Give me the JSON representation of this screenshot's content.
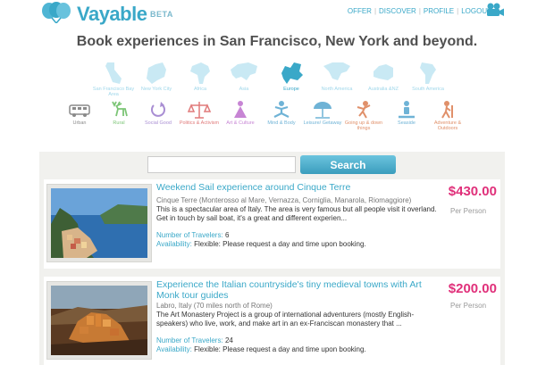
{
  "header": {
    "logo_text": "Vayable",
    "logo_beta": "BETA",
    "nav": [
      {
        "label": "OFFER"
      },
      {
        "label": "DISCOVER"
      },
      {
        "label": "PROFILE"
      },
      {
        "label": "LOGOUT"
      }
    ],
    "headline": "Book experiences in San Francisco, New York and beyond."
  },
  "colors": {
    "brand": "#3aa8c8",
    "price": "#e0307a",
    "panel_bg": "#f1f1ee",
    "headline": "#505050"
  },
  "regions": [
    {
      "label": "San Francisco Bay Area",
      "icon": "california-icon",
      "color": "#9fd7ea",
      "active": false
    },
    {
      "label": "New York City",
      "icon": "new-york-icon",
      "color": "#9fd7ea",
      "active": false
    },
    {
      "label": "Africa",
      "icon": "africa-icon",
      "color": "#9fd7ea",
      "active": false
    },
    {
      "label": "Asia",
      "icon": "asia-icon",
      "color": "#9fd7ea",
      "active": false
    },
    {
      "label": "Europe",
      "icon": "europe-icon",
      "color": "#3aa8c8",
      "active": true
    },
    {
      "label": "North America",
      "icon": "north-america-icon",
      "color": "#9fd7ea",
      "active": false
    },
    {
      "label": "Australia &NZ",
      "icon": "australia-icon",
      "color": "#9fd7ea",
      "active": false
    },
    {
      "label": "South America",
      "icon": "south-america-icon",
      "color": "#9fd7ea",
      "active": false
    }
  ],
  "categories": [
    {
      "label": "Urban",
      "icon": "bus-icon",
      "color": "#8a8a8a"
    },
    {
      "label": "Rural",
      "icon": "deer-icon",
      "color": "#7cc576"
    },
    {
      "label": "Social Good",
      "icon": "recycle-icon",
      "color": "#a98ed3"
    },
    {
      "label": "Politics & Activism",
      "icon": "scales-icon",
      "color": "#e07a7a"
    },
    {
      "label": "Art & Culture",
      "icon": "artist-icon",
      "color": "#c785d4"
    },
    {
      "label": "Mind & Body",
      "icon": "meditation-icon",
      "color": "#6fb3d6"
    },
    {
      "label": "Leisure/ Getaway",
      "icon": "umbrella-icon",
      "color": "#6fb3d6"
    },
    {
      "label": "Going up & down things",
      "icon": "climber-icon",
      "color": "#e0906a"
    },
    {
      "label": "Seaside",
      "icon": "surfer-icon",
      "color": "#6fb3d6"
    },
    {
      "label": "Adventure & Outdoors",
      "icon": "hiker-icon",
      "color": "#e0906a"
    }
  ],
  "search": {
    "placeholder": "",
    "value": "",
    "button_label": "Search"
  },
  "listings": [
    {
      "title": "Weekend Sail experience around Cinque Terre",
      "location": "Cinque Terre (Monterosso al Mare, Vernazza, Corniglia, Manarola, Riomaggiore)",
      "description": "This is a spectacular area of Italy. The area is very famous but all people visit it overland. Get in touch by sail boat, it's a great and different experien...",
      "travelers_label": "Number of Travelers:",
      "travelers": "6",
      "availability_label": "Availability:",
      "availability": "Flexible: Please request a day and time upon booking.",
      "price": "$430.00",
      "per": "Per Person"
    },
    {
      "title": "Experience the Italian countryside's tiny medieval towns with Art Monk tour guides",
      "location": "Labro, Italy (70 miles north of Rome)",
      "description": "The Art Monastery Project is a group of international adventurers (mostly English-speakers) who live, work, and make art in an ex-Franciscan monastery that ...",
      "travelers_label": "Number of Travelers:",
      "travelers": "24",
      "availability_label": "Availability:",
      "availability": "Flexible: Please request a day and time upon booking.",
      "price": "$200.00",
      "per": "Per Person"
    }
  ]
}
